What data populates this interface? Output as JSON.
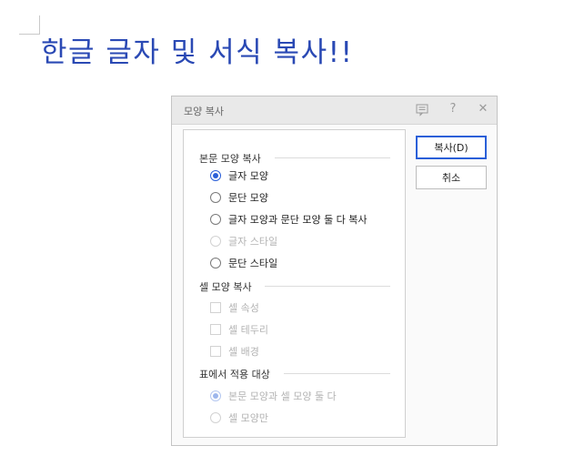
{
  "document": {
    "heading": "한글 글자 및 서식 복사!!"
  },
  "dialog": {
    "title": "모양 복사",
    "titlebar_icons": [
      "comment-icon",
      "help-icon",
      "close-icon"
    ],
    "help_glyph": "?",
    "close_glyph": "✕",
    "sections": {
      "body": {
        "title": "본문 모양 복사",
        "options": [
          {
            "label": "글자 모양",
            "checked": true,
            "disabled": false
          },
          {
            "label": "문단 모양",
            "checked": false,
            "disabled": false
          },
          {
            "label": "글자 모양과 문단 모양 둘 다 복사",
            "checked": false,
            "disabled": false
          },
          {
            "label": "글자 스타일",
            "checked": false,
            "disabled": true
          },
          {
            "label": "문단 스타일",
            "checked": false,
            "disabled": false
          }
        ]
      },
      "cell": {
        "title": "셀 모양 복사",
        "options": [
          {
            "label": "셀 속성",
            "checked": false,
            "disabled": true
          },
          {
            "label": "셀 테두리",
            "checked": false,
            "disabled": true
          },
          {
            "label": "셀 배경",
            "checked": false,
            "disabled": true
          }
        ]
      },
      "table": {
        "title": "표에서 적용 대상",
        "options": [
          {
            "label": "본문 모양과 셀 모양 둘 다",
            "checked": true,
            "disabled": true
          },
          {
            "label": "셀 모양만",
            "checked": false,
            "disabled": true
          }
        ]
      }
    },
    "buttons": {
      "copy": "복사(D)",
      "cancel": "취소"
    },
    "colors": {
      "accent": "#2a5fd8",
      "heading": "#2a49b4"
    }
  }
}
